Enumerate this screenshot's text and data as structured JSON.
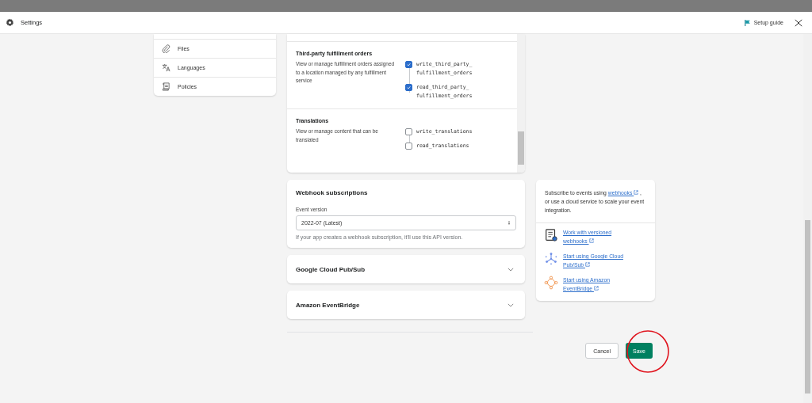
{
  "header": {
    "title": "Settings",
    "setup_guide": "Setup guide"
  },
  "sidebar": {
    "items": [
      {
        "label": "Files"
      },
      {
        "label": "Languages"
      },
      {
        "label": "Policies"
      }
    ]
  },
  "scopes": [
    {
      "title": "Third-party fulfillment orders",
      "description": "View or manage fulfillment orders assigned to a location managed by any fulfillment service",
      "permissions": [
        {
          "lines": [
            "write_third_party_",
            "fulfillment_orders"
          ],
          "checked": true
        },
        {
          "lines": [
            "read_third_party_",
            "fulfillment_orders"
          ],
          "checked": true
        }
      ]
    },
    {
      "title": "Translations",
      "description": "View or manage content that can be translated",
      "permissions": [
        {
          "lines": [
            "write_translations"
          ],
          "checked": false
        },
        {
          "lines": [
            "read_translations"
          ],
          "checked": false
        }
      ]
    }
  ],
  "webhooks": {
    "title": "Webhook subscriptions",
    "field_label": "Event version",
    "value": "2022-07 (Latest)",
    "help": "If your app creates a webhook subscription, it'll use this API version."
  },
  "accordions": [
    {
      "title": "Google Cloud Pub/Sub",
      "expanded": false
    },
    {
      "title": "Amazon EventBridge",
      "expanded": false
    }
  ],
  "aside": {
    "intro_before": "Subscribe to events using",
    "link": "webhooks",
    "intro_after": ", or use a cloud service to scale your event integration.",
    "resources": [
      {
        "kind": "scroll",
        "label": "Work with versioned webhooks"
      },
      {
        "kind": "pubsub",
        "label": "Start using Google Cloud Pub/Sub"
      },
      {
        "kind": "eventbridge",
        "label": "Start using Amazon EventBridge"
      }
    ]
  },
  "buttons": {
    "cancel": "Cancel",
    "save": "Save"
  }
}
